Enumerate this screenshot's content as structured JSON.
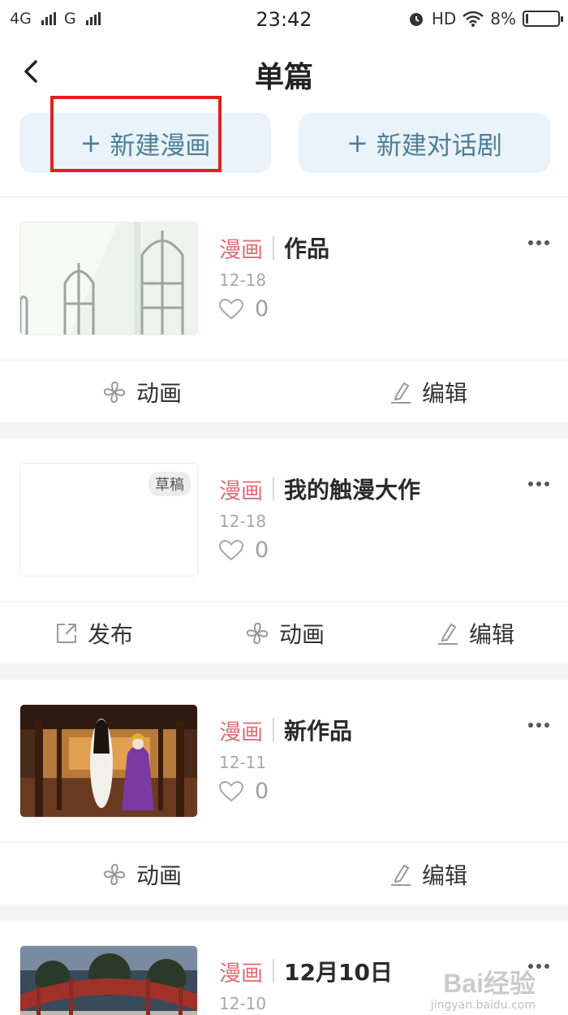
{
  "status_bar": {
    "network1": "4G",
    "network2": "G",
    "time": "23:42",
    "hd": "HD",
    "battery": "8%",
    "battery_level": 0.08
  },
  "nav": {
    "title": "单篇",
    "back_icon": "chevron-left-icon"
  },
  "actions_top": {
    "new_comic_label": "新建漫画",
    "new_drama_label": "新建对话剧",
    "plus": "+"
  },
  "accent_colors": {
    "tag": "#df6f78",
    "button_bg": "#e9f3f9",
    "button_text": "#4f7e99",
    "highlight": "#e02020"
  },
  "works": [
    {
      "tag": "漫画",
      "title": "作品",
      "date": "12-18",
      "likes": "0",
      "draft": "",
      "actions": {
        "animate": "动画",
        "edit": "编辑"
      }
    },
    {
      "tag": "漫画",
      "title": "我的触漫大作",
      "date": "12-18",
      "likes": "0",
      "draft": "草稿",
      "actions": {
        "publish": "发布",
        "animate": "动画",
        "edit": "编辑"
      }
    },
    {
      "tag": "漫画",
      "title": "新作品",
      "date": "12-11",
      "likes": "0",
      "draft": "",
      "actions": {
        "animate": "动画",
        "edit": "编辑"
      }
    },
    {
      "tag": "漫画",
      "title": "12月10日",
      "date": "12-10",
      "likes": "",
      "draft": "",
      "actions": {}
    }
  ],
  "watermark": {
    "text": "Bai经验",
    "sub": "jingyan.baidu.com"
  }
}
